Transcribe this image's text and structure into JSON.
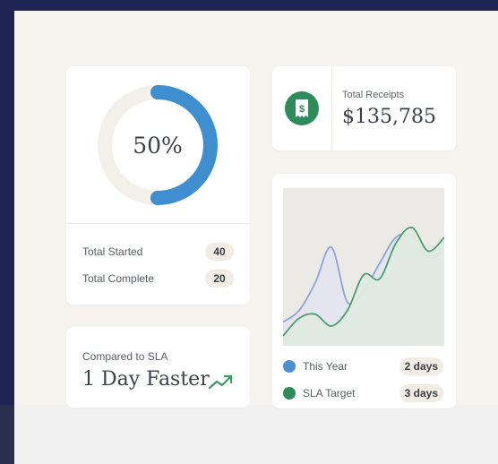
{
  "progress": {
    "percent_label": "50%",
    "fraction": 0.5
  },
  "stats": [
    {
      "label": "Total Started",
      "value": "40"
    },
    {
      "label": "Total Complete",
      "value": "20"
    }
  ],
  "receipts": {
    "label": "Total Receipts",
    "value": "$135,785",
    "icon": "receipt-dollar-icon"
  },
  "sla": {
    "label": "Compared to SLA",
    "value": "1 Day Faster",
    "icon": "trend-up-icon"
  },
  "chart_data": {
    "type": "area",
    "x": [
      0,
      1,
      2,
      3,
      4,
      5,
      6,
      7,
      8,
      9,
      10
    ],
    "series": [
      {
        "name": "This Year",
        "values": [
          12,
          18,
          32,
          50,
          22,
          28,
          42,
          55,
          56,
          45,
          48
        ],
        "color": "#8aa6d9"
      },
      {
        "name": "SLA Target",
        "values": [
          5,
          14,
          16,
          10,
          18,
          36,
          34,
          52,
          60,
          48,
          55
        ],
        "color": "#4f9d6f"
      }
    ]
  },
  "legend": [
    {
      "label": "This Year",
      "value": "2 days",
      "color": "#4a90d2"
    },
    {
      "label": "SLA Target",
      "value": "3 days",
      "color": "#2f8c5a"
    }
  ],
  "colors": {
    "accent_blue": "#3f8fd0",
    "accent_green": "#2f8c5a",
    "background": "#f6f3ee"
  }
}
